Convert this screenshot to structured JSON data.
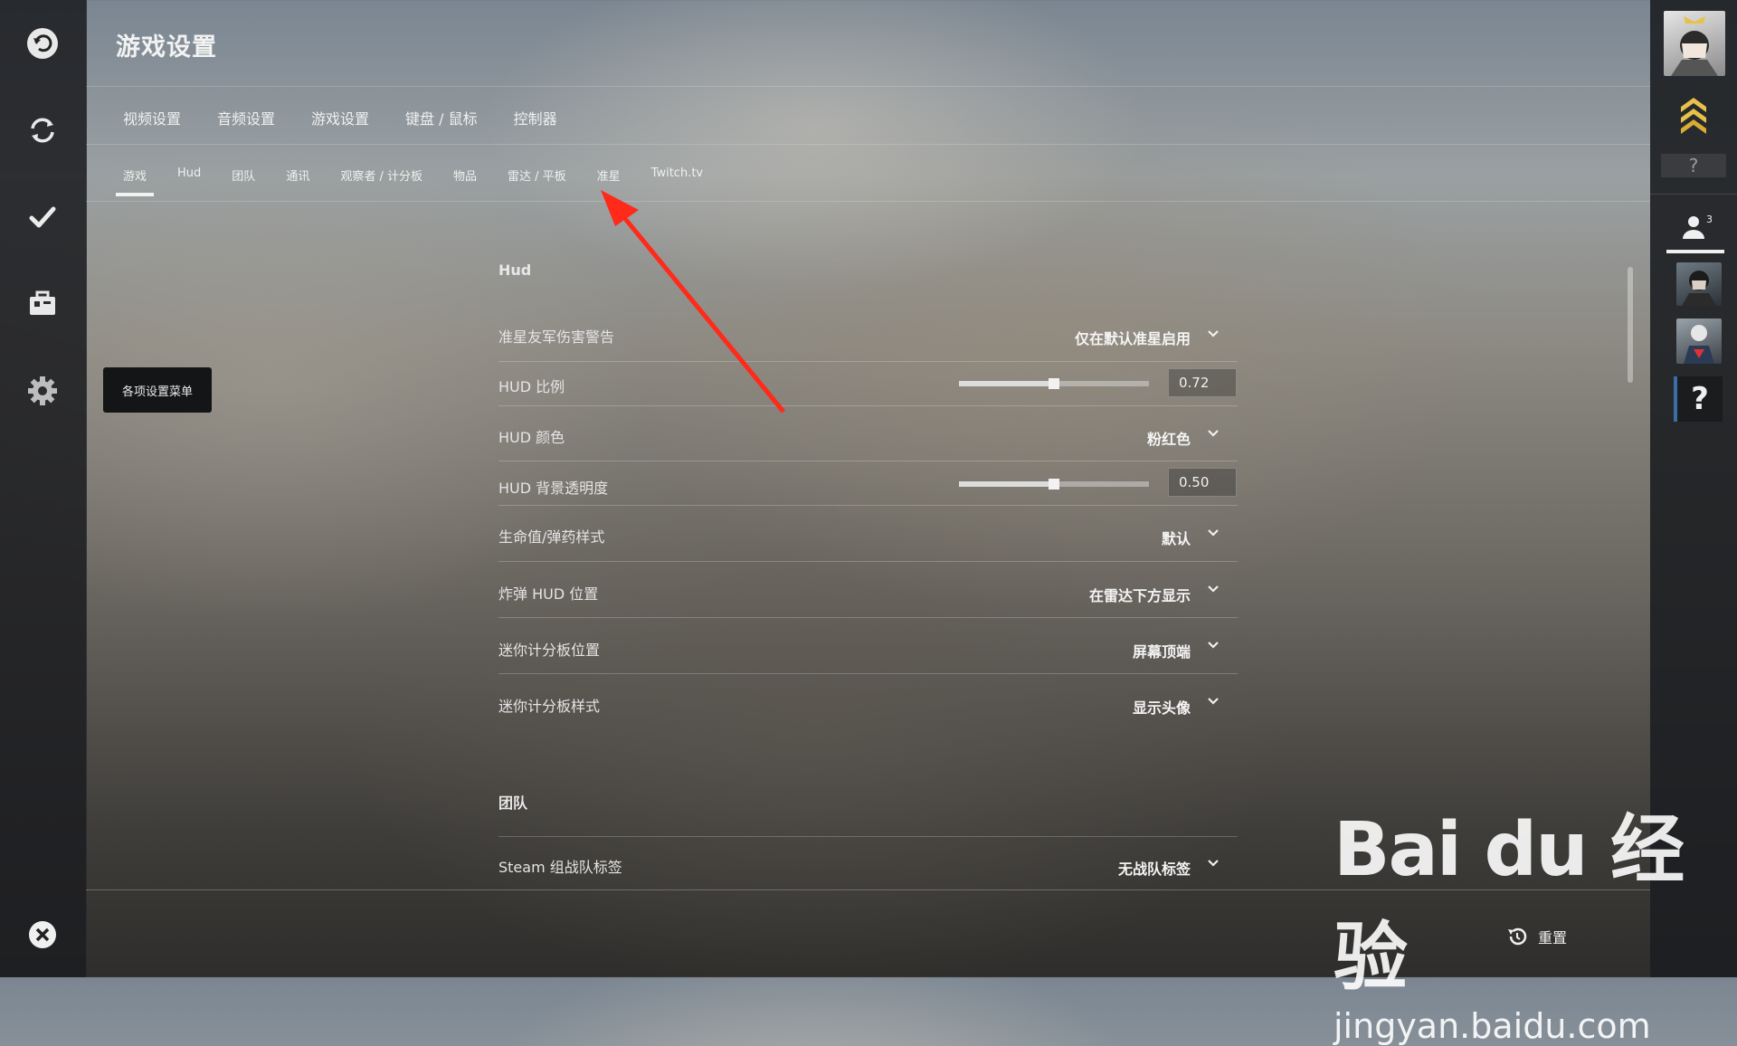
{
  "header": {
    "title": "游戏设置"
  },
  "main_tabs": [
    "视频设置",
    "音频设置",
    "游戏设置",
    "键盘 / 鼠标",
    "控制器"
  ],
  "sub_tabs": [
    "游戏",
    "Hud",
    "团队",
    "通讯",
    "观察者 / 计分板",
    "物品",
    "雷达 / 平板",
    "准星",
    "Twitch.tv"
  ],
  "active_sub_tab": "游戏",
  "tooltip": "各项设置菜单",
  "sections": {
    "hud": {
      "title": "Hud",
      "rows": [
        {
          "label": "准星友军伤害警告",
          "value": "仅在默认准星启用"
        },
        {
          "label": "HUD 比例",
          "value": "0.72",
          "level": 0.5
        },
        {
          "label": "HUD 颜色",
          "value": "粉红色"
        },
        {
          "label": "HUD 背景透明度",
          "value": "0.50",
          "level": 0.5
        },
        {
          "label": "生命值/弹药样式",
          "value": "默认"
        },
        {
          "label": "炸弹 HUD 位置",
          "value": "在雷达下方显示"
        },
        {
          "label": "迷你计分板位置",
          "value": "屏幕顶端"
        },
        {
          "label": "迷你计分板样式",
          "value": "显示头像"
        }
      ]
    },
    "team": {
      "title": "团队",
      "rows": [
        {
          "label": "Steam 组战队标签",
          "value": "无战队标签"
        }
      ]
    }
  },
  "bottom": {
    "reset_label": "重置"
  },
  "rightbar": {
    "friends_count": "3",
    "rank_unknown": "?",
    "unknown_avatar": "?"
  },
  "watermark": {
    "logo": "Bai du 经验",
    "url": "jingyan.baidu.com"
  },
  "icons": [
    "back-icon",
    "refresh-icon",
    "check-icon",
    "briefcase-icon",
    "gear-icon",
    "close-icon",
    "chevron-down-icon",
    "reset-icon",
    "friends-icon",
    "rank-chevron-icon"
  ],
  "colors": {
    "annotation_arrow": "#ff2a1a",
    "rank_gold": "#e8c14a"
  }
}
